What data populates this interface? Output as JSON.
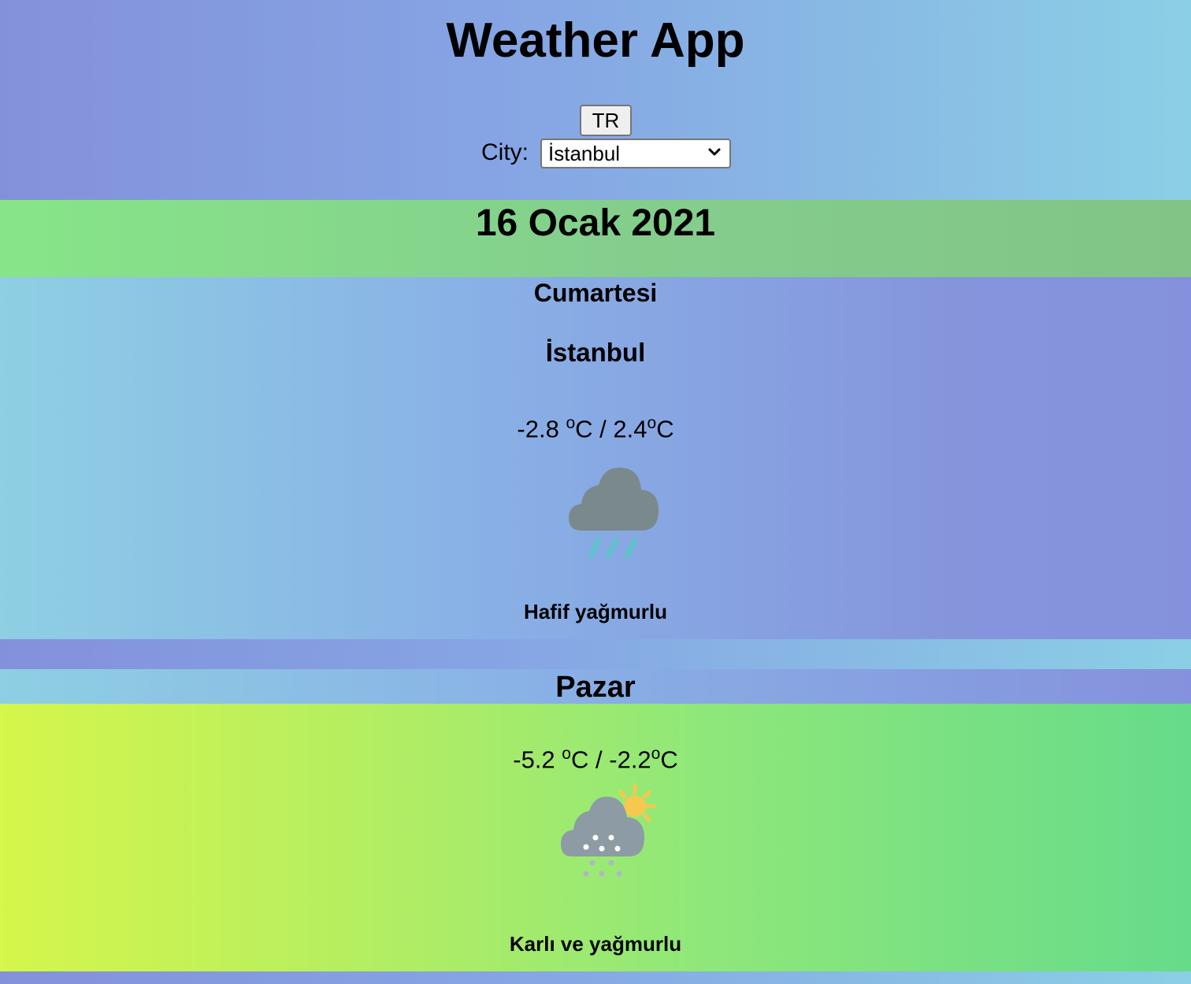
{
  "header": {
    "title": "Weather App",
    "language_button": "TR",
    "city_label": "City:",
    "city_selected": "İstanbul"
  },
  "date": "16 Ocak 2021",
  "forecast": [
    {
      "weekday": "Cumartesi",
      "city": "İstanbul",
      "min_temp": "-2.8",
      "max_temp": "2.4",
      "unit": "C",
      "degree_mark": "o",
      "separator": "/",
      "icon": "cloud-rain-icon",
      "description": "Hafif yağmurlu"
    },
    {
      "weekday": "Pazar",
      "min_temp": "-5.2",
      "max_temp": "-2.2",
      "unit": "C",
      "degree_mark": "o",
      "separator": "/",
      "icon": "snow-rain-sun-icon",
      "description": "Karlı ve yağmurlu"
    }
  ],
  "colors": {
    "cloud_dark": "#7a8a8c",
    "cloud_light": "#8d9ba4",
    "rain": "#5bc4c9",
    "sun": "#f5c84f"
  }
}
